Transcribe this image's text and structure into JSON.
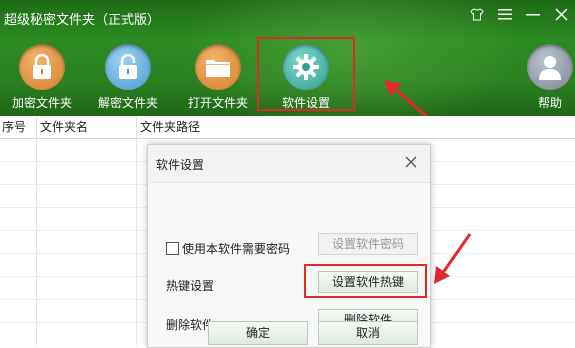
{
  "app": {
    "title": "超级秘密文件夹（正式版）"
  },
  "window_controls": [
    "shirt-icon",
    "menu-icon",
    "minimize-icon",
    "close-icon"
  ],
  "toolbar": {
    "buttons": [
      {
        "label": "加密文件夹",
        "icon": "lock-icon"
      },
      {
        "label": "解密文件夹",
        "icon": "unlock-icon"
      },
      {
        "label": "打开文件夹",
        "icon": "folder-icon"
      },
      {
        "label": "软件设置",
        "icon": "gear-icon"
      },
      {
        "label": "帮助",
        "icon": "user-icon"
      }
    ]
  },
  "table": {
    "columns": [
      "序号",
      "文件夹名",
      "文件夹路径"
    ]
  },
  "dialog": {
    "title": "软件设置",
    "password_checkbox_label": "使用本软件需要密码",
    "set_password_button": "设置软件密码",
    "hotkey_label": "热键设置",
    "set_hotkey_button": "设置软件热键",
    "delete_label": "删除软件",
    "delete_button": "删除软件",
    "ok_button": "确定",
    "cancel_button": "取消"
  },
  "colors": {
    "top_bar": "#2c8a22",
    "highlight": "#e02a2a"
  }
}
